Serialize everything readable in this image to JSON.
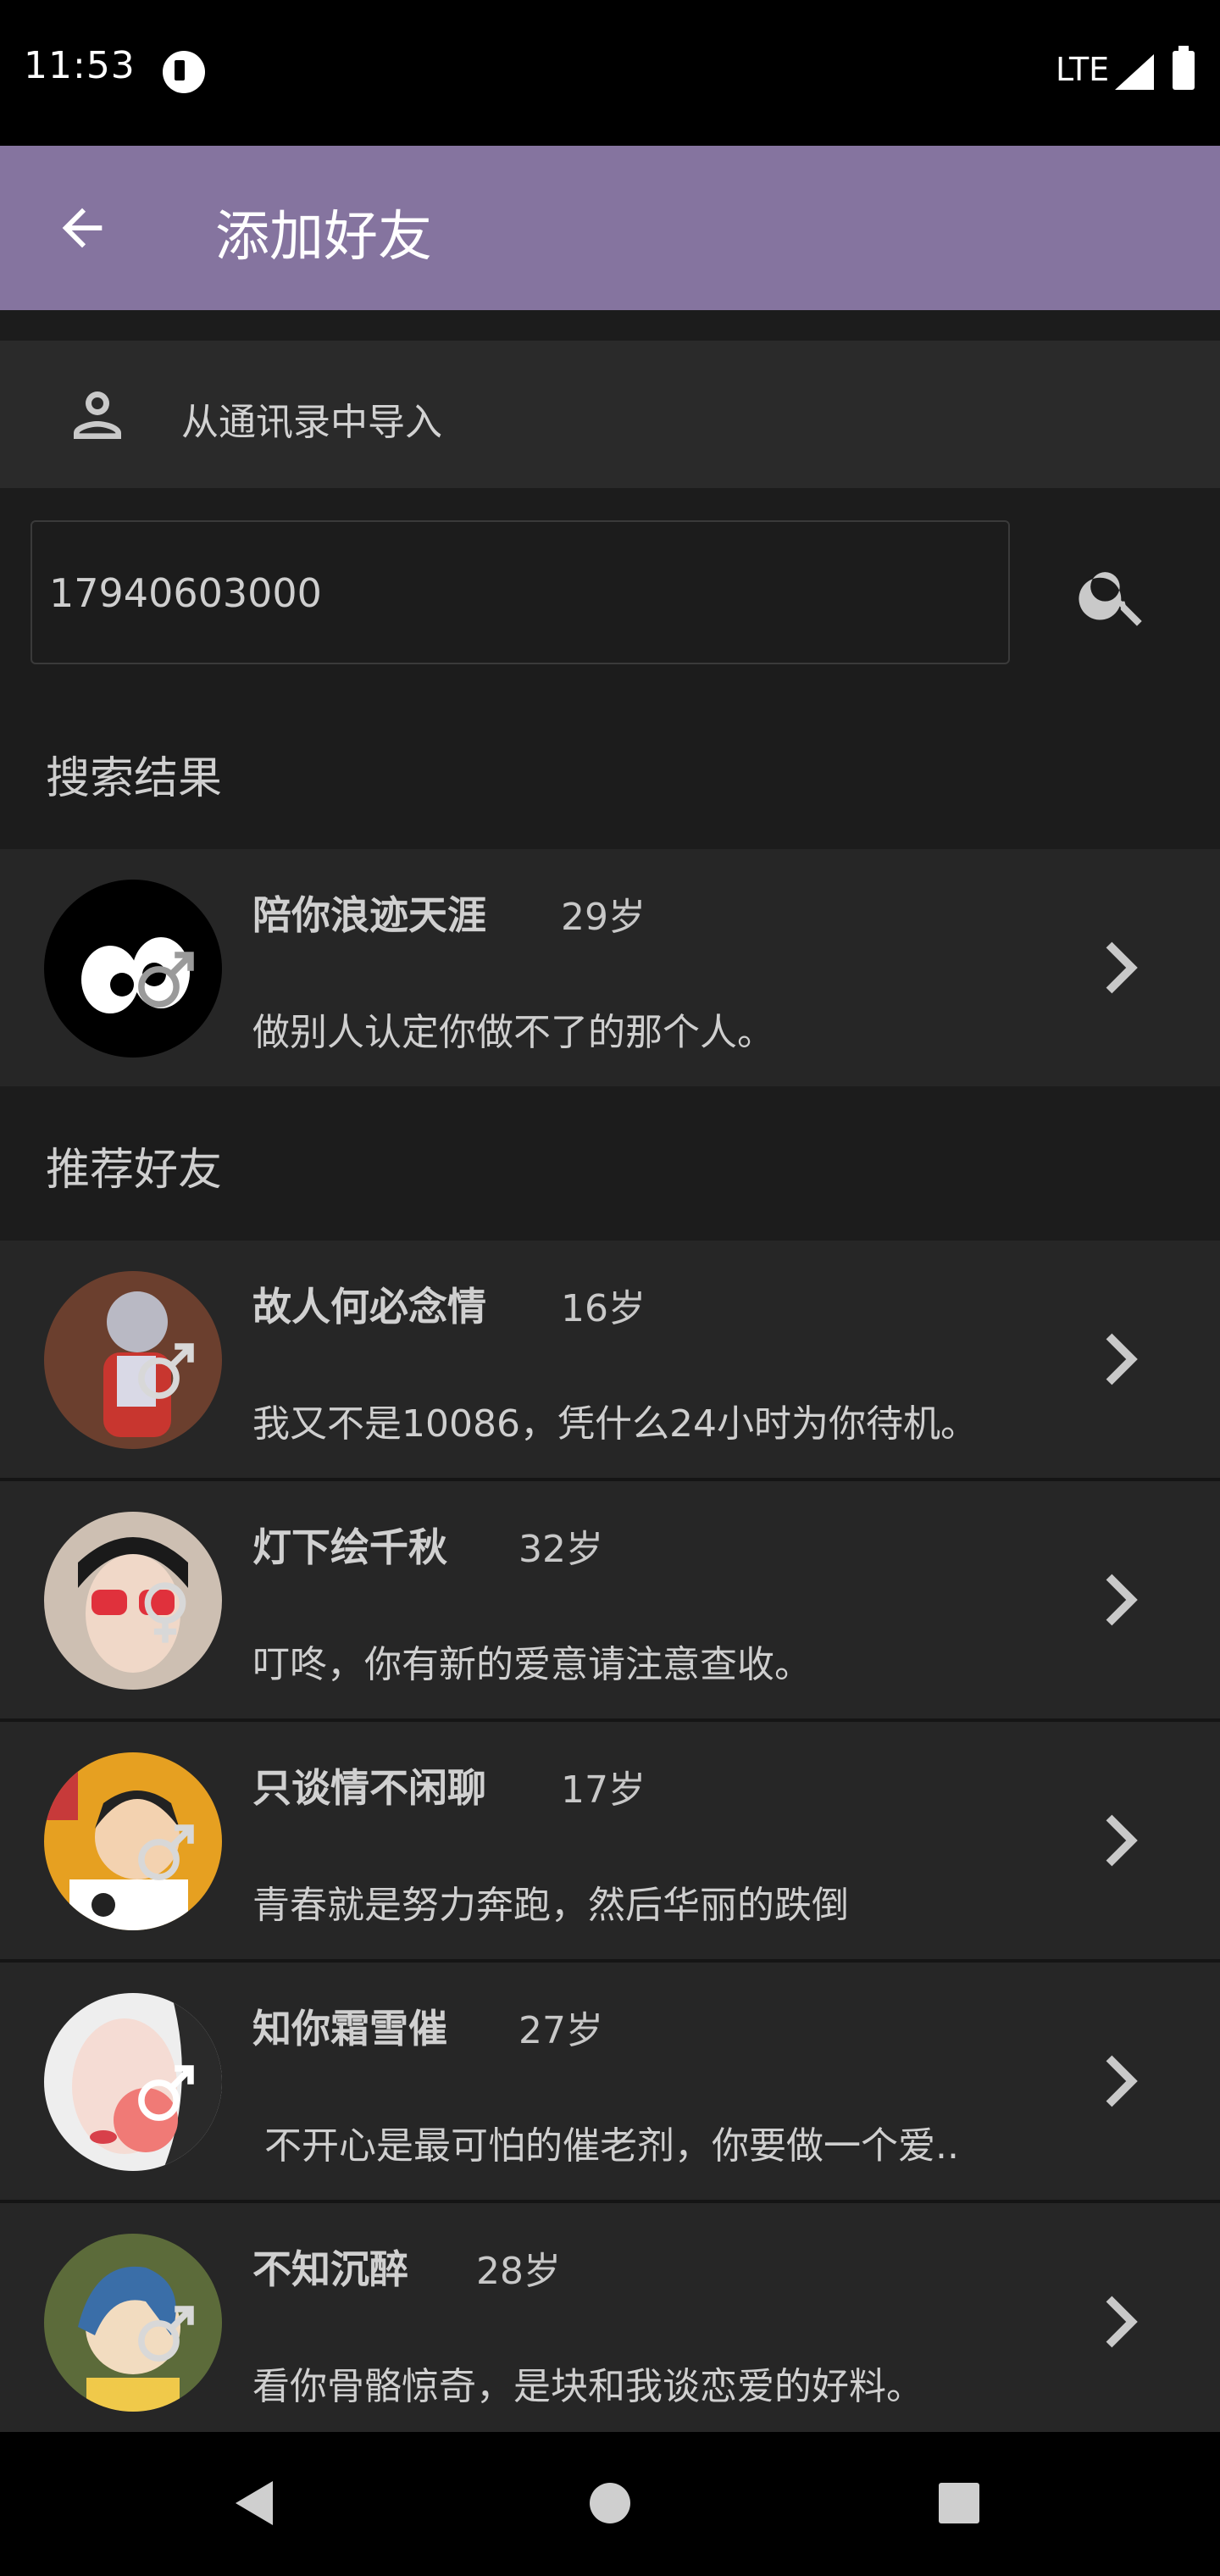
{
  "status_bar": {
    "time": "11:53",
    "network": "LTE"
  },
  "app_bar": {
    "title": "添加好友",
    "back_icon": "arrow-left-icon"
  },
  "import": {
    "label": "从通讯录中导入",
    "icon": "person-icon"
  },
  "search": {
    "value": "17940603000",
    "button_icon": "search-icon"
  },
  "sections": {
    "results_title": "搜索结果",
    "recommend_title": "推荐好友"
  },
  "search_results": [
    {
      "name": "陪你浪迹天涯",
      "age": "29岁",
      "signature": "做别人认定你做不了的那个人。",
      "gender": "male"
    }
  ],
  "recommended": [
    {
      "name": "故人何必念情",
      "age": "16岁",
      "signature": "我又不是10086，凭什么24小时为你待机。",
      "gender": "male"
    },
    {
      "name": "灯下绘千秋",
      "age": "32岁",
      "signature": "叮咚，你有新的爱意请注意查收。",
      "gender": "female"
    },
    {
      "name": "只谈情不闲聊",
      "age": "17岁",
      "signature": "青春就是努力奔跑，然后华丽的跌倒",
      "gender": "male"
    },
    {
      "name": "知你霜雪催",
      "age": "27岁",
      "signature": " 不开心是最可怕的催老剂，你要做一个爱..",
      "gender": "male"
    },
    {
      "name": "不知沉醉",
      "age": "28岁",
      "signature": "看你骨骼惊奇，是块和我谈恋爱的好料。",
      "gender": "male"
    }
  ],
  "colors": {
    "app_bar": "#85749f",
    "background": "#1c1c1c",
    "row": "#262626"
  }
}
